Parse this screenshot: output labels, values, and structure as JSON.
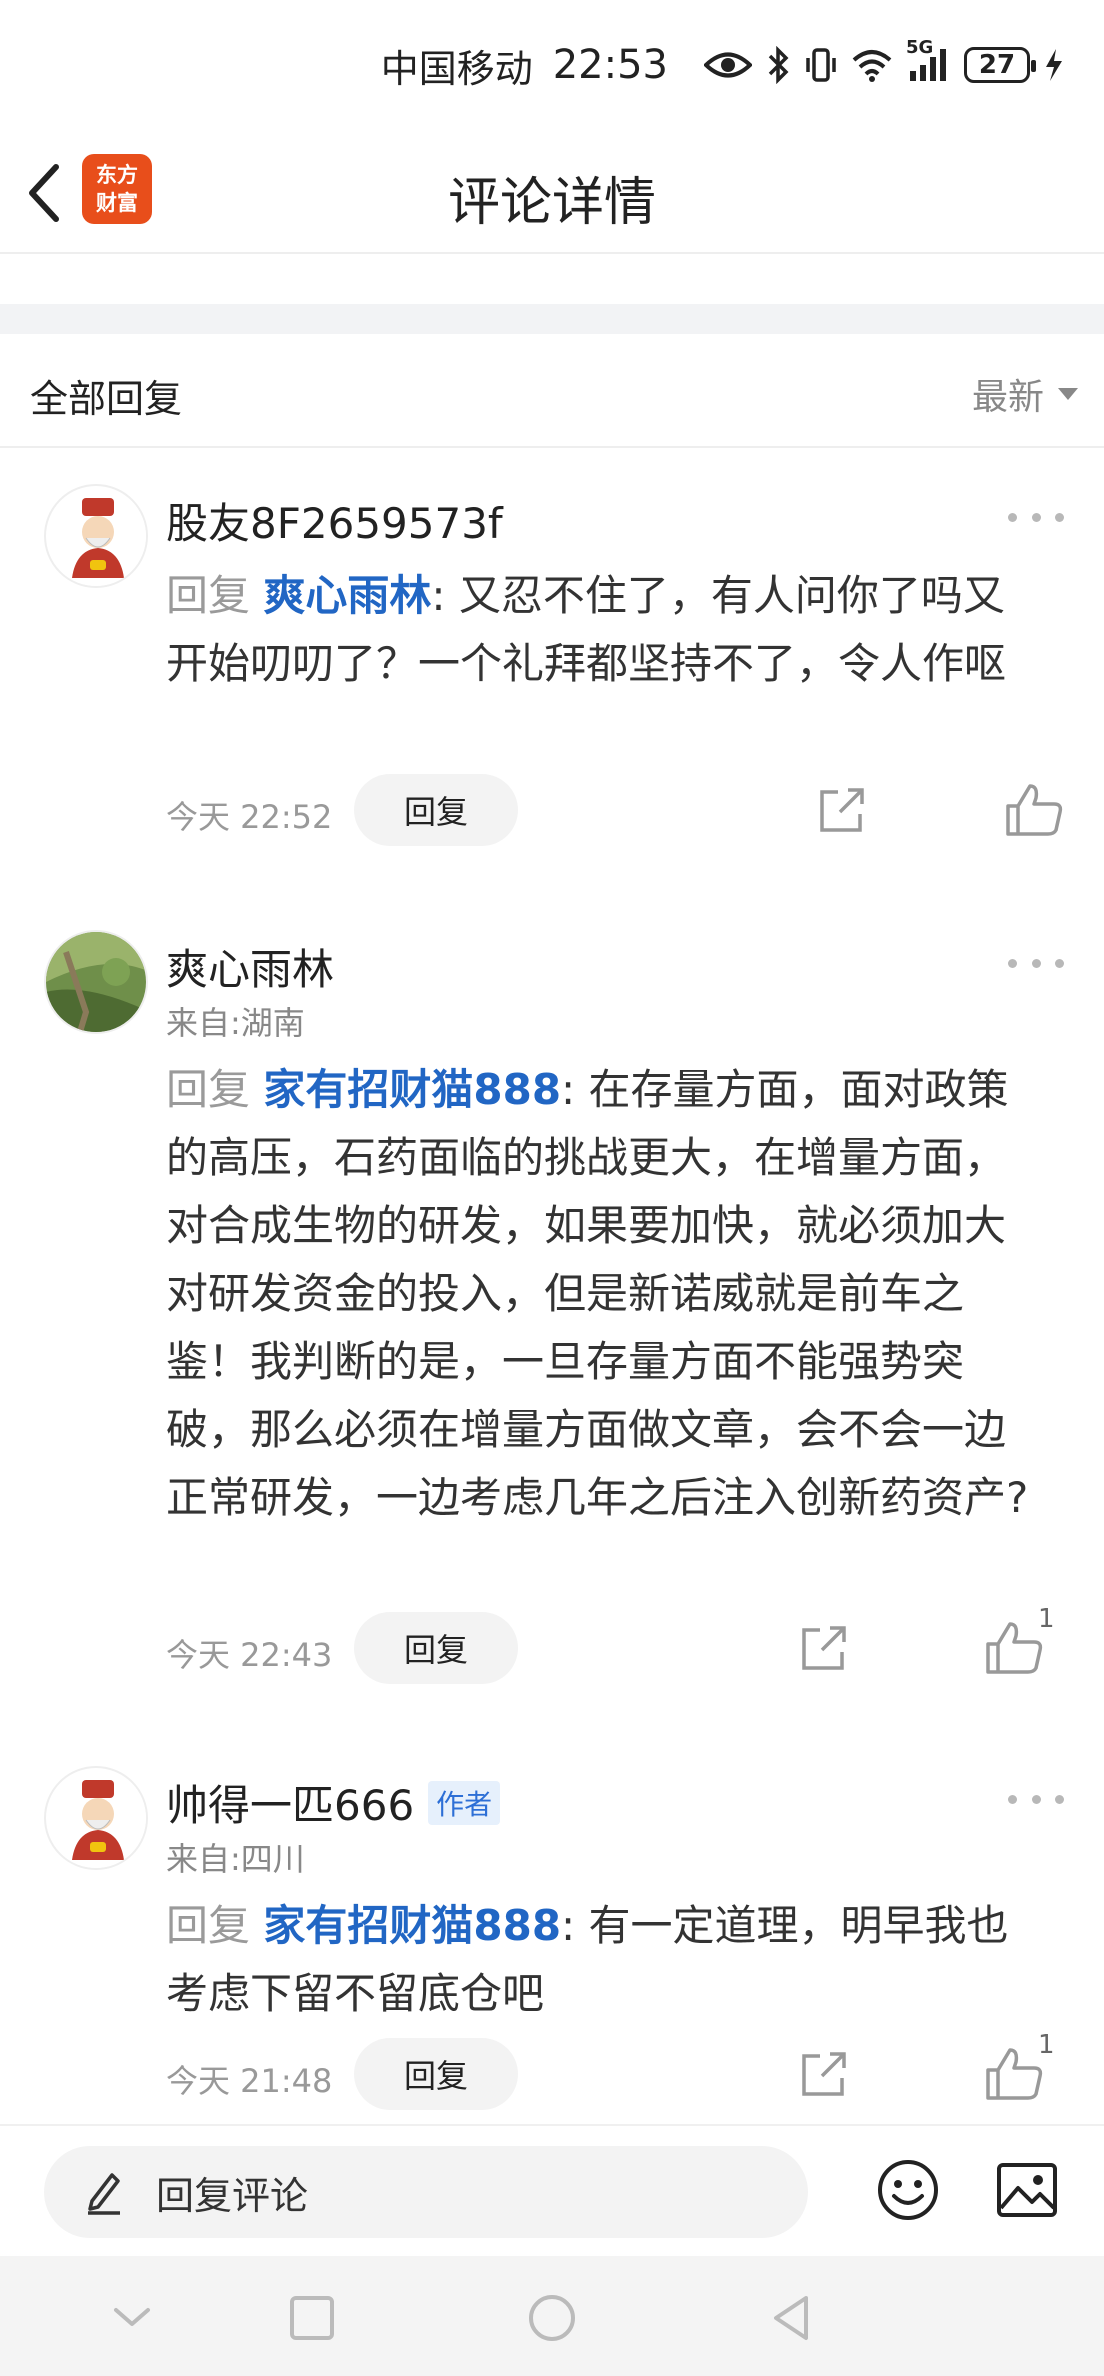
{
  "status_bar": {
    "carrier": "中国移动",
    "time": "22:53",
    "network": "5G",
    "battery": "27"
  },
  "header": {
    "logo_line1": "东方",
    "logo_line2": "财富",
    "title": "评论详情"
  },
  "replies_section": {
    "title": "全部回复",
    "sort_label": "最新"
  },
  "comments": [
    {
      "username": "股友8F2659573f",
      "location": "",
      "badge": "",
      "reply_prefix": "回复",
      "mention": "爽心雨林",
      "text": ": 又忍不住了，有人问你了吗又开始叨叨了？一个礼拜都坚持不了，令人作呕",
      "time": "今天 22:52",
      "reply_label": "回复",
      "likes": ""
    },
    {
      "username": "爽心雨林",
      "location": "来自:湖南",
      "badge": "",
      "reply_prefix": "回复",
      "mention": "家有招财猫888",
      "text": ": 在存量方面，面对政策的高压，石药面临的挑战更大，在增量方面，对合成生物的研发，如果要加快，就必须加大对研发资金的投入，但是新诺威就是前车之鉴！我判断的是，一旦存量方面不能强势突破，那么必须在增量方面做文章，会不会一边正常研发，一边考虑几年之后注入创新药资产?",
      "time": "今天 22:43",
      "reply_label": "回复",
      "likes": "1"
    },
    {
      "username": "帅得一匹666",
      "location": "来自:四川",
      "badge": "作者",
      "reply_prefix": "回复",
      "mention": "家有招财猫888",
      "text": ": 有一定道理，明早我也考虑下留不留底仓吧",
      "time": "今天 21:48",
      "reply_label": "回复",
      "likes": "1"
    }
  ],
  "input_bar": {
    "placeholder": "回复评论"
  },
  "icons": {
    "back": "chevron-left-icon",
    "more": "more-dots-icon",
    "share": "share-icon",
    "like": "thumbs-up-icon",
    "pen": "pen-icon",
    "emoji": "emoji-icon",
    "image": "image-icon"
  },
  "colors": {
    "brand": "#e84e1b",
    "mention": "#2166c4",
    "muted": "#999999"
  }
}
